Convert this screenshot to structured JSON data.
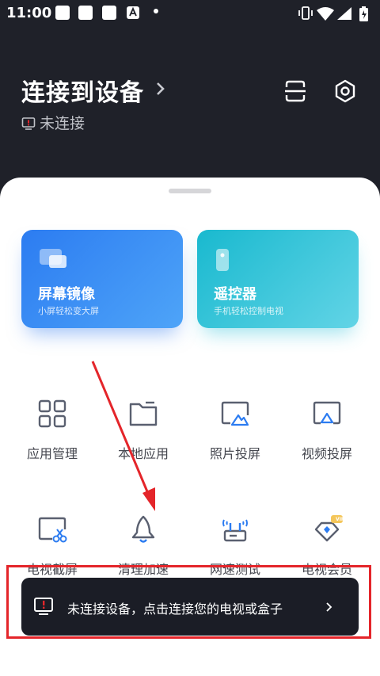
{
  "status_bar": {
    "time": "11:00",
    "notif_icons": [
      "app-icon",
      "app-icon",
      "app-icon",
      "a-icon"
    ],
    "system_icons": [
      "vibrate-icon",
      "wifi-icon",
      "signal-icon",
      "battery-icon"
    ]
  },
  "header": {
    "title": "连接到设备",
    "status": "未连接",
    "buttons": [
      "scan-icon",
      "settings-icon"
    ]
  },
  "cards": [
    {
      "title": "屏幕镜像",
      "subtitle": "小屏轻松变大屏",
      "color": "#2c7cf1"
    },
    {
      "title": "遥控器",
      "subtitle": "手机轻松控制电视",
      "color": "#19b9cf"
    }
  ],
  "grid": [
    {
      "label": "应用管理",
      "icon": "apps-grid-icon"
    },
    {
      "label": "本地应用",
      "icon": "folder-icon"
    },
    {
      "label": "照片投屏",
      "icon": "photo-cast-icon"
    },
    {
      "label": "视频投屏",
      "icon": "video-cast-icon"
    },
    {
      "label": "电视截屏",
      "icon": "tv-screenshot-icon"
    },
    {
      "label": "清理加速",
      "icon": "rocket-icon"
    },
    {
      "label": "网速测试",
      "icon": "router-icon"
    },
    {
      "label": "电视会员",
      "icon": "vip-diamond-icon",
      "badge": "VIP"
    }
  ],
  "toast": {
    "text": "未连接设备，点击连接您的电视或盒子"
  },
  "colors": {
    "header_bg": "#1f2129",
    "accent_blue": "#2c7cf1",
    "accent_teal": "#19b9cf",
    "icon_grey": "#5a6070",
    "annotation_red": "#e4252a"
  }
}
